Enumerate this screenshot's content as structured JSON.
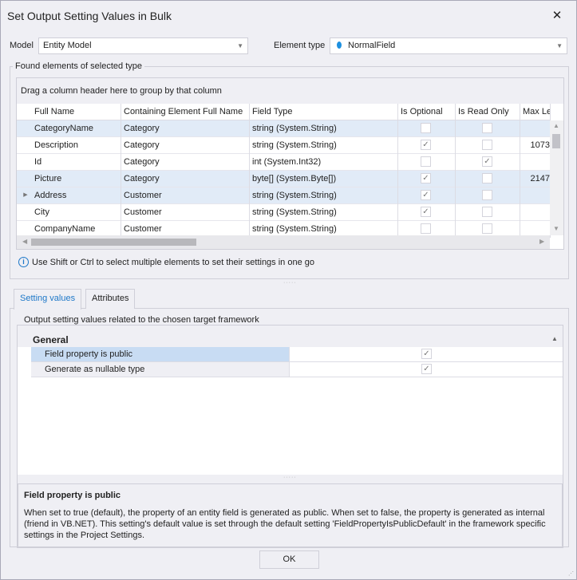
{
  "window": {
    "title": "Set Output Setting Values in Bulk",
    "close_glyph": "✕"
  },
  "model": {
    "label": "Model",
    "value": "Entity Model"
  },
  "element_type": {
    "label": "Element type",
    "value": "NormalField",
    "icon": "diamond-field-icon",
    "icon_color": "#1e90e0"
  },
  "found_group": {
    "title": "Found elements of selected type"
  },
  "grid": {
    "group_hint": "Drag a column header here to group by that column",
    "columns": [
      "Full Name",
      "Containing Element Full Name",
      "Field Type",
      "Is Optional",
      "Is Read Only",
      "Max Lengt"
    ],
    "rows": [
      {
        "name": "CategoryName",
        "container": "Category",
        "type": "string (System.String)",
        "optional": false,
        "readonly": false,
        "maxlen": "",
        "selected": true
      },
      {
        "name": "Description",
        "container": "Category",
        "type": "string (System.String)",
        "optional": true,
        "readonly": false,
        "maxlen": "1073",
        "selected": false
      },
      {
        "name": "Id",
        "container": "Category",
        "type": "int (System.Int32)",
        "optional": false,
        "readonly": true,
        "maxlen": "",
        "selected": false
      },
      {
        "name": "Picture",
        "container": "Category",
        "type": "byte[] (System.Byte[])",
        "optional": true,
        "readonly": false,
        "maxlen": "2147",
        "selected": true
      },
      {
        "name": "Address",
        "container": "Customer",
        "type": "string (System.String)",
        "optional": true,
        "readonly": false,
        "maxlen": "",
        "selected": true,
        "focused": true
      },
      {
        "name": "City",
        "container": "Customer",
        "type": "string (System.String)",
        "optional": true,
        "readonly": false,
        "maxlen": "",
        "selected": false
      },
      {
        "name": "CompanyName",
        "container": "Customer",
        "type": "string (System.String)",
        "optional": false,
        "readonly": false,
        "maxlen": "",
        "selected": false
      }
    ]
  },
  "info": {
    "text": "Use Shift or Ctrl to select multiple elements to set their settings in one go"
  },
  "tabs": [
    {
      "label": "Setting values",
      "active": true
    },
    {
      "label": "Attributes",
      "active": false
    }
  ],
  "settings": {
    "group_title": "Output setting values related to the chosen target framework",
    "category": "General",
    "items": [
      {
        "label": "Field property is public",
        "checked": true,
        "selected": true
      },
      {
        "label": "Generate as nullable type",
        "checked": true,
        "selected": false
      }
    ]
  },
  "description": {
    "title": "Field property is public",
    "text": "When set to true (default), the property of an entity field is generated as public. When set to false, the property is generated as internal (friend in VB.NET). This setting's default value is set through the default setting 'FieldPropertyIsPublicDefault' in the framework specific settings in the Project Settings."
  },
  "ok_button": {
    "label": "OK"
  },
  "colors": {
    "accent": "#1e78c8",
    "selection": "#e1ebf7",
    "property_selection": "#c8dcf3"
  }
}
